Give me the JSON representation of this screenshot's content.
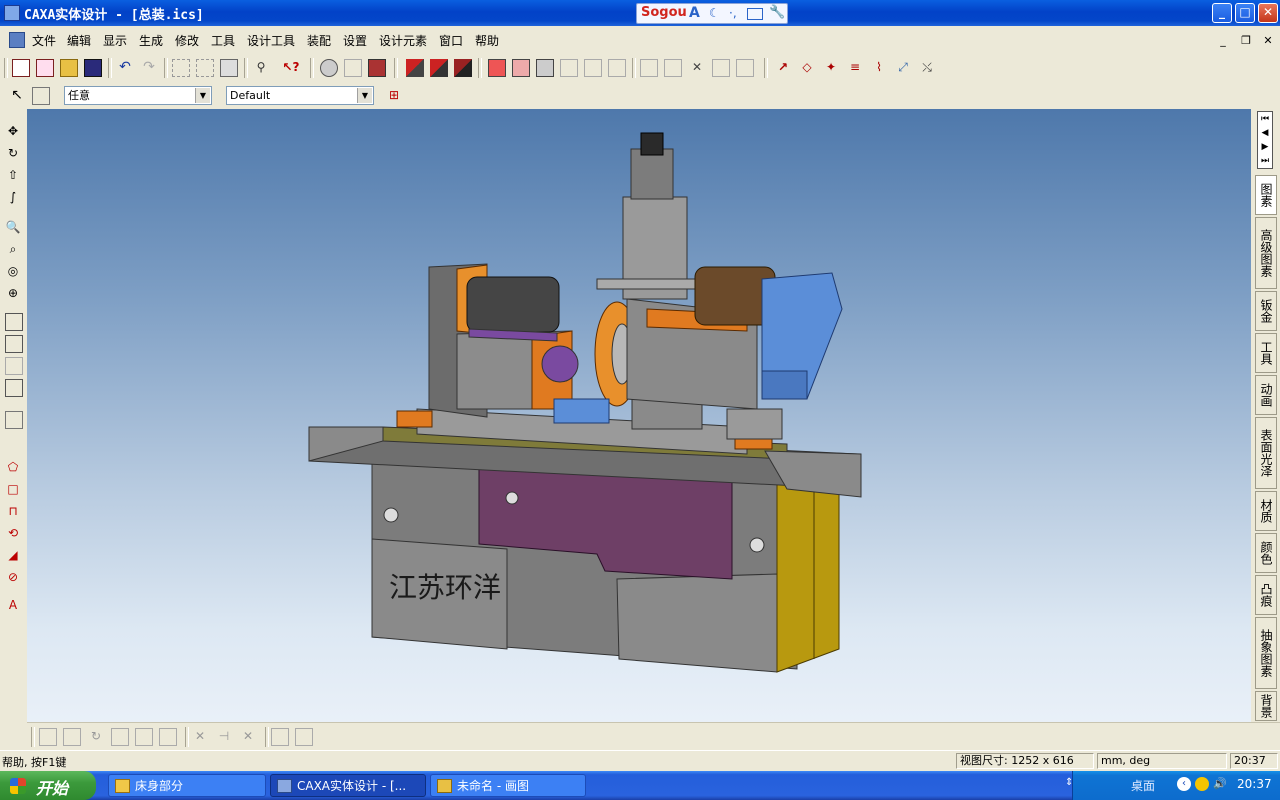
{
  "window": {
    "title": "CAXA实体设计 - [总装.ics]",
    "controls": {
      "minimize": "_",
      "maximize": "□",
      "close": "✕"
    }
  },
  "ime_bar": {
    "logo": "Sogou",
    "mode": "A"
  },
  "menu": {
    "items": [
      "文件",
      "编辑",
      "显示",
      "生成",
      "修改",
      "工具",
      "设计工具",
      "装配",
      "设置",
      "设计元素",
      "窗口",
      "帮助"
    ],
    "mdi_controls": {
      "minimize": "_",
      "restore": "❐",
      "close": "✕"
    }
  },
  "toolbar2": {
    "selection_filter": "任意",
    "style_combo": "Default"
  },
  "right_panel": {
    "nav": [
      "⏮",
      "◀",
      "▶",
      "⏭"
    ],
    "tabs": [
      "图素",
      "高级图素",
      "钣金",
      "工具",
      "动画",
      "表面光泽",
      "材质",
      "颜色",
      "凸痕",
      "抽象图素",
      "背景"
    ],
    "active_tab": 0
  },
  "viewport": {
    "background_top": "#4e78ab",
    "background_bottom": "#e9f0f8",
    "model_label": "江苏环洋"
  },
  "statusbar": {
    "help": "帮助, 按F1键",
    "view_size": "视图尺寸: 1252 x  616",
    "units": "mm, deg",
    "time": "20:37"
  },
  "taskbar": {
    "start_label": "开始",
    "buttons": [
      {
        "label": "床身部分",
        "active": false
      },
      {
        "label": "CAXA实体设计 - [...",
        "active": true
      },
      {
        "label": "未命名 - 画图",
        "active": false
      }
    ],
    "tray_desktop": "桌面",
    "tray_time": "20:37"
  },
  "colors": {
    "titlebar": "#0242c8",
    "taskbar": "#245edb",
    "start": "#3c9a3c",
    "machine_gray": "#7f7f7f",
    "motor_blue": "#5b8ed8",
    "wheel_orange": "#e8902c",
    "panel_purple": "#6e3f66",
    "guard_yellow": "#b89a10"
  }
}
